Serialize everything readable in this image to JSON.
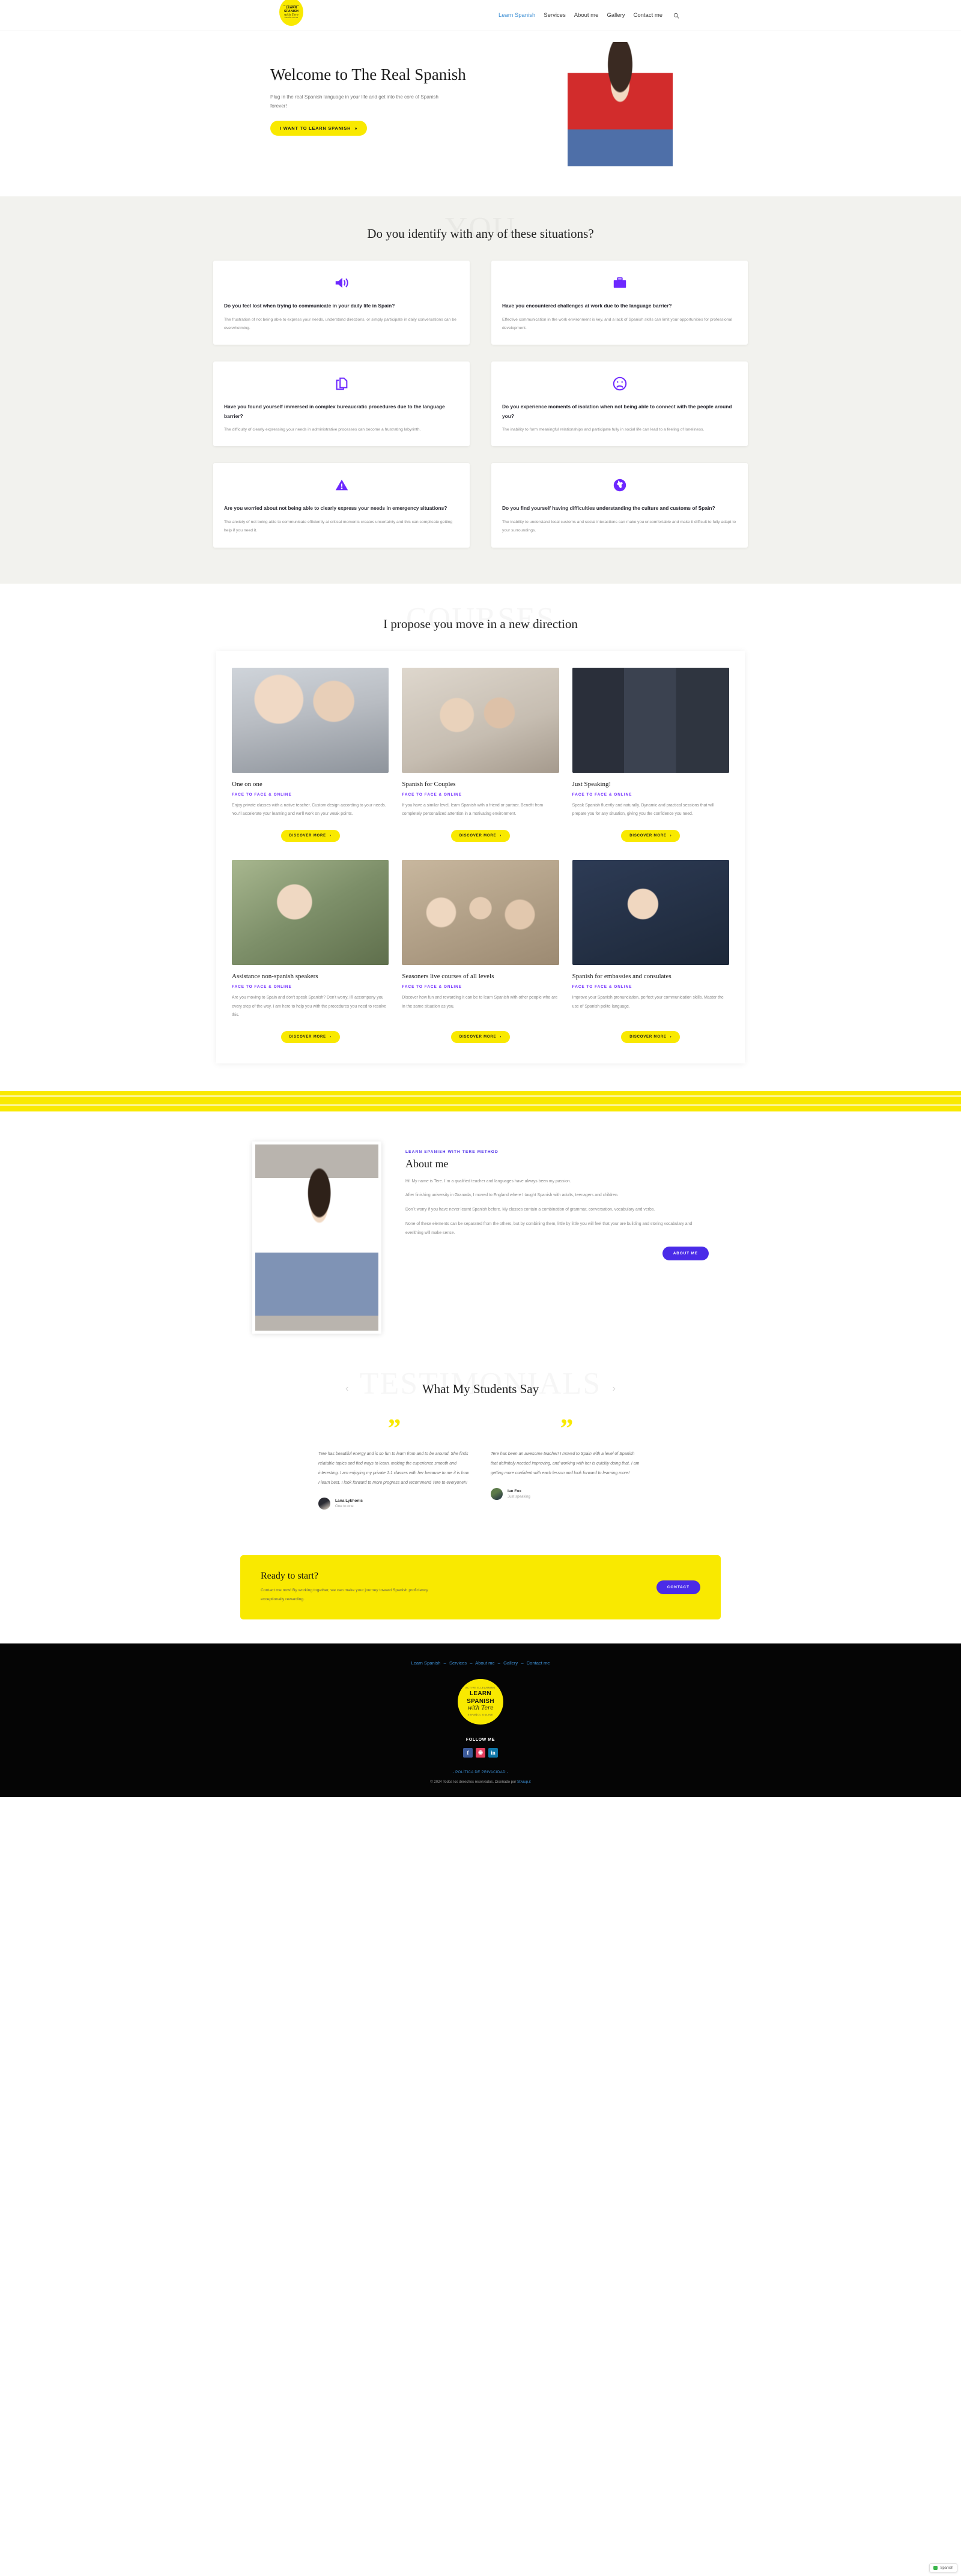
{
  "header": {
    "logo": {
      "top": "ACTIVE E-LEARNING",
      "line1": "LEARN",
      "line2": "SPANISH",
      "script": "with Tere",
      "bottom": "ESPAÑOL ONLINE"
    },
    "nav": [
      {
        "label": "Learn Spanish",
        "active": true
      },
      {
        "label": "Services",
        "active": false
      },
      {
        "label": "About me",
        "active": false
      },
      {
        "label": "Gallery",
        "active": false
      },
      {
        "label": "Contact me",
        "active": false
      }
    ],
    "search_icon": "search-icon"
  },
  "hero": {
    "title": "Welcome to The Real Spanish",
    "subtitle": "Plug in the real Spanish language in your life and get into the core of Spanish forever!",
    "cta": "I WANT TO LEARN SPANISH",
    "cta_chevron": "»"
  },
  "situations": {
    "watermark": "YOU",
    "title": "Do you identify with any of these situations?",
    "cards": [
      {
        "icon": "speaker-icon",
        "title": "Do you feel lost when trying to communicate in your daily life in Spain?",
        "desc": "The frustration of not being able to express your needs, understand directions, or simply participate in daily conversations can be overwhelming."
      },
      {
        "icon": "briefcase-icon",
        "title": "Have you encountered challenges at work due to the language barrier?",
        "desc": "Effective communication in the work environment is key, and a lack of Spanish skills can limit your opportunities for professional development."
      },
      {
        "icon": "documents-icon",
        "title": "Have you found yourself immersed in complex bureaucratic procedures due to the language barrier?",
        "desc": "The difficulty of clearly expressing your needs in administrative processes can become a frustrating labyrinth."
      },
      {
        "icon": "sad-face-icon",
        "title": "Do you experience moments of isolation when not being able to connect with the people around you?",
        "desc": "The inability to form meaningful relationships and participate fully in social life can lead to a feeling of loneliness."
      },
      {
        "icon": "warning-triangle-icon",
        "title": "Are you worried about not being able to clearly express your needs in emergency situations?",
        "desc": "The anxiety of not being able to communicate efficiently at critical moments creates uncertainty and this can complicate getting help if you need it."
      },
      {
        "icon": "globe-icon",
        "title": "Do you find yourself having difficulties understanding the culture and customs of Spain?",
        "desc": "The inability to understand local customs and social interactions can make you uncomfortable and make it difficult to fully adapt to your surroundings."
      }
    ]
  },
  "courses": {
    "watermark": "COURSES",
    "title": "I propose you move in a new direction",
    "cta_label": "DISCOVER MORE",
    "cta_chevron": "›",
    "items": [
      {
        "name": "One on one",
        "tag": "FACE TO FACE & ONLINE",
        "desc": "Enjoy private classes with a native teacher. Custom design according to your needs. You'll accelerate your learning and we'll work on your weak points.",
        "photo": "two-women-smiling-photo"
      },
      {
        "name": "Spanish for Couples",
        "tag": "FACE TO FACE & ONLINE",
        "desc": "If you have a similar level, learn Spanish with a friend or partner. Benefit from completely personalized attention in a motivating environment.",
        "photo": "couple-studying-photo"
      },
      {
        "name": "Just Speaking!",
        "tag": "FACE TO FACE & ONLINE",
        "desc": "Speak Spanish fluently and naturally. Dynamic and practical sessions that will prepare you for any situation, giving you the confidence you need.",
        "photo": "video-call-grid-photo"
      },
      {
        "name": "Assistance non-spanish speakers",
        "tag": "FACE TO FACE & ONLINE",
        "desc": "Are you moving to Spain and don't speak Spanish? Don't worry, I'll accompany you every step of the way. I am here to help you with the procedures you need to resolve this.",
        "photo": "two-people-outdoors-photo"
      },
      {
        "name": "Seasoners live courses of all levels",
        "tag": "FACE TO FACE & ONLINE",
        "desc": "Discover how fun and rewarding it can be to learn Spanish with other people who are in the same situation as you.",
        "photo": "group-dinner-photo"
      },
      {
        "name": "Spanish for embassies and consulates",
        "tag": "FACE TO FACE & ONLINE",
        "desc": "Improve your Spanish pronunciation, perfect your communication skills. Master the use of Spanish polite language.",
        "photo": "man-video-call-photo"
      }
    ]
  },
  "about": {
    "eyebrow": "LEARN SPANISH WITH TERE METHOD",
    "title": "About me",
    "paragraphs": [
      "Hi! My name is Tere. I´m a qualified teacher and languages have always been my passion.",
      "After finishing university in Granada, I moved to England where I taught Spanish with adults, teenagers and children.",
      "Don´t worry if you have never learnt Spanish before. My classes contain a combination of grammar, conversation, vocabulary and verbs.",
      "None of these elements can be separated from the others, but by combining them, little by little you will feel that your are building and storing vocabulary and everithing will make sense."
    ],
    "button": "ABOUT ME",
    "photo": "tere-portrait-photo"
  },
  "testimonials": {
    "watermark": "TESTIMONIALS",
    "title": "What My Students Say",
    "quote_glyph": "”",
    "prev_arrow": "‹",
    "next_arrow": "›",
    "items": [
      {
        "text": "Tere has beautiful energy and is so fun to learn from and to be around. She finds relatable topics and find ways to learn, making the experience smooth and interesting. I am enjoying my private 1:1 classes with her because to me it is how I learn best. I look forward to more progress and recommend Tere to everyone!!!",
        "name": "Lana Lykhonis",
        "role": "One to one"
      },
      {
        "text": "Tere has been an awesome teacher! I moved to Spain with a level of Spanish that definitely needed improving, and working with her is quickly doing that. I am getting more confident with each lesson and look forward to learning more!",
        "name": "Ian Fox",
        "role": "Just speaking"
      }
    ]
  },
  "cta": {
    "title": "Ready to start?",
    "subtitle": "Contact me now! By working together, we can make your journey toward Spanish proficiency exceptionally rewarding.",
    "button": "CONTACT"
  },
  "footer": {
    "nav": [
      {
        "label": "Learn Spanish"
      },
      {
        "label": "Services"
      },
      {
        "label": "About me"
      },
      {
        "label": "Gallery"
      },
      {
        "label": "Contact me"
      }
    ],
    "separator": "–",
    "logo": {
      "top": "ACTIVE E-LEARNING",
      "line1": "LEARN",
      "line2": "SPANISH",
      "script": "with Tere",
      "bottom": "ESPAÑOL ONLINE"
    },
    "follow": "FOLLOW ME",
    "socials": [
      {
        "name": "facebook-icon",
        "glyph": "f"
      },
      {
        "name": "instagram-icon",
        "glyph": "◉"
      },
      {
        "name": "linkedin-icon",
        "glyph": "in"
      }
    ],
    "privacy": "- POLÍTICA DE PRIVACIDAD -",
    "copyright": "© 2024 Todos los derechos reservados. Diseñado por",
    "credit": "Stiviup.it"
  },
  "widget": {
    "label": "Spanish",
    "dot_color": "#3ab54a"
  },
  "colors": {
    "yellow": "#F9E900",
    "purple": "#4A2BE8",
    "accent_blue": "#3d8fd4",
    "dark": "#050505"
  }
}
